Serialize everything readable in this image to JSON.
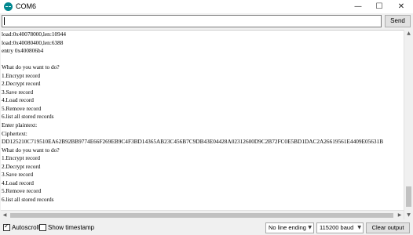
{
  "window": {
    "title": "COM6",
    "minimize_glyph": "—",
    "maximize_glyph": "☐",
    "close_glyph": "✕"
  },
  "send_bar": {
    "input_value": "",
    "send_label": "Send"
  },
  "output": {
    "lines": [
      "load:0x40078000,len:10944",
      "load:0x40080400,len:6388",
      "entry 0x400806b4",
      "",
      "What do you want to do?",
      "1.Encrypt record",
      "2.Decrypt record",
      "3.Save record",
      "4.Load record",
      "5.Remove record",
      "6.list all stored records",
      "Enter plaintext:",
      "Ciphertext:",
      "DD125210C719510EA62B92BB9774E66F269EB9C4F3BD14365AB23C456B7C9DB43E04428A02312600D9C2B72FC0E5BD1DAC2A26619561E4409E05631B",
      "What do you want to do?",
      "1.Encrypt record",
      "2.Decrypt record",
      "3.Save record",
      "4.Load record",
      "5.Remove record",
      "6.list all stored records"
    ]
  },
  "status_bar": {
    "autoscroll_label": "Autoscroll",
    "autoscroll_checked": true,
    "timestamp_label": "Show timestamp",
    "timestamp_checked": false,
    "line_ending": "No line ending",
    "baud_rate": "115200 baud",
    "clear_label": "Clear output"
  },
  "icons": {
    "app": "arduino-icon",
    "dropdown": "chevron-down-icon"
  },
  "colors": {
    "app_icon": "#00878f",
    "button_bg": "#e1e1e1"
  }
}
